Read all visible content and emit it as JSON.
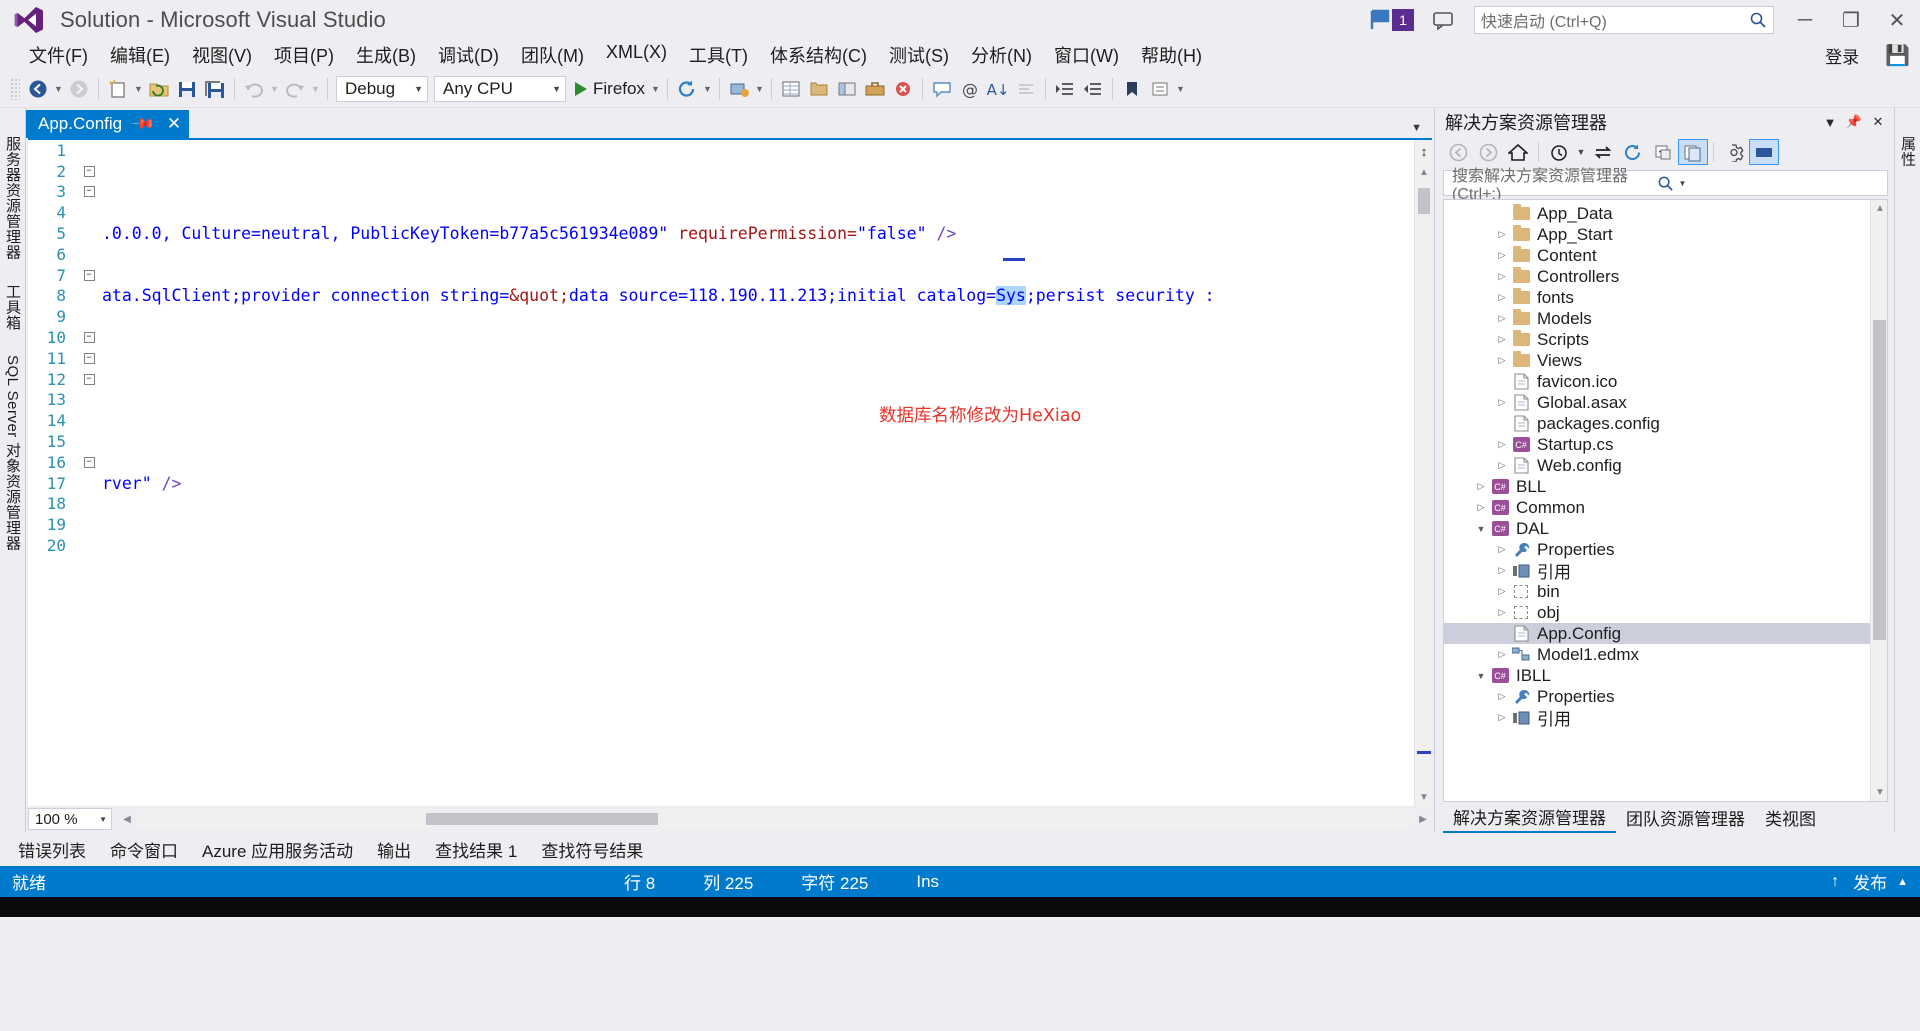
{
  "titlebar": {
    "app_title": "Solution - Microsoft Visual Studio",
    "logo_name": "visual-studio-logo",
    "notification_count": "1",
    "quick_launch_placeholder": "快速启动 (Ctrl+Q)",
    "minimize": "─",
    "maximize": "❐",
    "close": "✕"
  },
  "menubar": {
    "items": [
      {
        "label": "文件(F)"
      },
      {
        "label": "编辑(E)"
      },
      {
        "label": "视图(V)"
      },
      {
        "label": "项目(P)"
      },
      {
        "label": "生成(B)"
      },
      {
        "label": "调试(D)"
      },
      {
        "label": "团队(M)"
      },
      {
        "label": "XML(X)"
      },
      {
        "label": "工具(T)"
      },
      {
        "label": "体系结构(C)"
      },
      {
        "label": "测试(S)"
      },
      {
        "label": "分析(N)"
      },
      {
        "label": "窗口(W)"
      },
      {
        "label": "帮助(H)"
      }
    ],
    "signin": "登录"
  },
  "toolbar": {
    "configuration": "Debug",
    "platform": "Any CPU",
    "run_target": "Firefox"
  },
  "editor": {
    "tab_label": "App.Config",
    "zoom": "100 %",
    "lines": [
      {
        "num": "1",
        "fold": "",
        "text": ""
      },
      {
        "num": "2",
        "fold": "minus",
        "text": ""
      },
      {
        "num": "3",
        "fold": "minus",
        "text": ""
      },
      {
        "num": "4",
        "fold": "",
        "text": ""
      },
      {
        "num": "5",
        "fold": "",
        "text": ".0.0.0, Culture=neutral, PublicKeyToken=b77a5c561934e089\" requirePermission=\"false\" />"
      },
      {
        "num": "6",
        "fold": "",
        "text": ""
      },
      {
        "num": "7",
        "fold": "minus",
        "text": ""
      },
      {
        "num": "8",
        "fold": "",
        "text": "ata.SqlClient;provider connection string=&quot;data source=118.190.11.213;initial catalog=Sys;persist security :"
      },
      {
        "num": "9",
        "fold": "",
        "text": ""
      },
      {
        "num": "10",
        "fold": "minus",
        "text": ""
      },
      {
        "num": "11",
        "fold": "minus",
        "text": ""
      },
      {
        "num": "12",
        "fold": "minus",
        "text": ""
      },
      {
        "num": "13",
        "fold": "",
        "text": ""
      },
      {
        "num": "14",
        "fold": "",
        "text": ""
      },
      {
        "num": "15",
        "fold": "",
        "text": ""
      },
      {
        "num": "16",
        "fold": "minus",
        "text": ""
      },
      {
        "num": "17",
        "fold": "",
        "text": "rver\" />"
      },
      {
        "num": "18",
        "fold": "",
        "text": ""
      },
      {
        "num": "19",
        "fold": "",
        "text": ""
      },
      {
        "num": "20",
        "fold": "",
        "text": ""
      }
    ],
    "line5_segments": [
      {
        "t": ".0.0.0, Culture=neutral, PublicKeyToken=b77a5c561934e089",
        "c": "k-blue"
      },
      {
        "t": "\"",
        "c": "k-blue"
      },
      {
        "t": " requirePermission=",
        "c": "k-red"
      },
      {
        "t": "\"false\"",
        "c": "k-blue"
      },
      {
        "t": " />",
        "c": "k-purple"
      }
    ],
    "line8_segments": [
      {
        "t": "ata.SqlClient;provider connection string=",
        "c": "k-blue"
      },
      {
        "t": "&quot;",
        "c": "k-red"
      },
      {
        "t": "data source=118.190.11.213;initial catalog=",
        "c": "k-blue"
      },
      {
        "t": "Sys",
        "c": "sel"
      },
      {
        "t": ";persist security :",
        "c": "k-blue"
      }
    ],
    "line17_segments": [
      {
        "t": "rver\" ",
        "c": "k-blue"
      },
      {
        "t": "/>",
        "c": "k-purple"
      }
    ],
    "annotation": "数据库名称修改为HeXiao"
  },
  "left_rail": {
    "tabs": [
      "服务器资源管理器",
      "工具箱",
      "SQL Server 对象资源管理器"
    ]
  },
  "right_rail": {
    "tabs": [
      "属性"
    ]
  },
  "solution_explorer": {
    "title": "解决方案资源管理器",
    "search_placeholder": "搜索解决方案资源管理器(Ctrl+;)",
    "toolbar_icons": [
      "back-icon",
      "forward-icon",
      "home-icon",
      "pending-changes-icon",
      "sync-icon",
      "refresh-icon",
      "collapse-all-icon",
      "show-all-files-icon",
      "properties-icon",
      "preview-icon"
    ],
    "tree": [
      {
        "indent": 2,
        "twist": "",
        "icon": "folder",
        "label": "App_Data"
      },
      {
        "indent": 2,
        "twist": "▷",
        "icon": "folder",
        "label": "App_Start"
      },
      {
        "indent": 2,
        "twist": "▷",
        "icon": "folder",
        "label": "Content"
      },
      {
        "indent": 2,
        "twist": "▷",
        "icon": "folder",
        "label": "Controllers"
      },
      {
        "indent": 2,
        "twist": "▷",
        "icon": "folder",
        "label": "fonts"
      },
      {
        "indent": 2,
        "twist": "▷",
        "icon": "folder",
        "label": "Models"
      },
      {
        "indent": 2,
        "twist": "▷",
        "icon": "folder",
        "label": "Scripts"
      },
      {
        "indent": 2,
        "twist": "▷",
        "icon": "folder",
        "label": "Views"
      },
      {
        "indent": 2,
        "twist": "",
        "icon": "file",
        "label": "favicon.ico"
      },
      {
        "indent": 2,
        "twist": "▷",
        "icon": "file",
        "label": "Global.asax"
      },
      {
        "indent": 2,
        "twist": "",
        "icon": "file",
        "label": "packages.config"
      },
      {
        "indent": 2,
        "twist": "▷",
        "icon": "csharp",
        "label": "Startup.cs"
      },
      {
        "indent": 2,
        "twist": "▷",
        "icon": "file",
        "label": "Web.config"
      },
      {
        "indent": 1,
        "twist": "▷",
        "icon": "csharp",
        "label": "BLL"
      },
      {
        "indent": 1,
        "twist": "▷",
        "icon": "csharp",
        "label": "Common"
      },
      {
        "indent": 1,
        "twist": "▼",
        "icon": "csharp",
        "label": "DAL"
      },
      {
        "indent": 2,
        "twist": "▷",
        "icon": "wrench",
        "label": "Properties"
      },
      {
        "indent": 2,
        "twist": "▷",
        "icon": "reference",
        "label": "引用"
      },
      {
        "indent": 2,
        "twist": "▷",
        "icon": "dashed",
        "label": "bin"
      },
      {
        "indent": 2,
        "twist": "▷",
        "icon": "dashed",
        "label": "obj"
      },
      {
        "indent": 2,
        "twist": "",
        "icon": "file",
        "label": "App.Config",
        "selected": true
      },
      {
        "indent": 2,
        "twist": "▷",
        "icon": "edmx",
        "label": "Model1.edmx"
      },
      {
        "indent": 1,
        "twist": "▼",
        "icon": "csharp",
        "label": "IBLL"
      },
      {
        "indent": 2,
        "twist": "▷",
        "icon": "wrench",
        "label": "Properties"
      },
      {
        "indent": 2,
        "twist": "▷",
        "icon": "reference",
        "label": "引用"
      }
    ],
    "bottom_tabs": [
      {
        "label": "解决方案资源管理器",
        "active": true
      },
      {
        "label": "团队资源管理器",
        "active": false
      },
      {
        "label": "类视图",
        "active": false
      }
    ]
  },
  "bottom_tabs": [
    "错误列表",
    "命令窗口",
    "Azure 应用服务活动",
    "输出",
    "查找结果 1",
    "查找符号结果"
  ],
  "statusbar": {
    "ready": "就绪",
    "line_label": "行 8",
    "col_label": "列 225",
    "char_label": "字符 225",
    "insert_mode": "Ins",
    "publish": "发布"
  },
  "colors": {
    "accent": "#007ACC",
    "chrome": "#EEEEF2",
    "annotation_red": "#E8332A",
    "selection_blue": "#ADD6FF",
    "folder_gold": "#DCB67A",
    "csharp_purple": "#9B4F96"
  }
}
